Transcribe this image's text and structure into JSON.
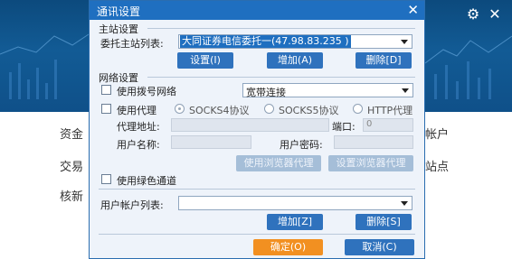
{
  "background": {
    "left_labels": [
      "资金",
      "交易",
      "核新"
    ],
    "right_labels": [
      "帐户",
      "站点"
    ],
    "icons": [
      "gear-icon",
      "close-icon"
    ]
  },
  "dialog": {
    "title": "通讯设置",
    "close_glyph": "✕",
    "main_station": {
      "section": "主站设置",
      "list_label": "委托主站列表:",
      "selected_value": "大同证券电信委托一(47.98.83.235 )",
      "buttons": {
        "settings": "设置(I)",
        "add": "增加(A)",
        "delete": "删除[D]"
      }
    },
    "network": {
      "section": "网络设置",
      "dialup_label": "使用拨号网络",
      "dialup_value": "宽带连接",
      "proxy_label": "使用代理",
      "proxy_options": [
        "SOCKS4协议",
        "SOCKS5协议",
        "HTTP代理"
      ],
      "proxy_address_label": "代理地址:",
      "port_label": "端口:",
      "port_value": "0",
      "username_label": "用户名称:",
      "password_label": "用户密码:",
      "browser_proxy_btn": "使用浏览器代理",
      "set_browser_proxy_btn": "设置浏览器代理",
      "green_channel_label": "使用绿色通道"
    },
    "accounts": {
      "list_label": "用户帐户列表:",
      "add_btn": "增加[Z]",
      "delete_btn": "删除[S]"
    },
    "ok_btn": "确定(O)",
    "cancel_btn": "取消(C)"
  },
  "colors": {
    "title_bar": "#1f6fc0",
    "button": "#2f72bd",
    "primary_button": "#f29021",
    "dialog_bg": "#eef3fa"
  }
}
